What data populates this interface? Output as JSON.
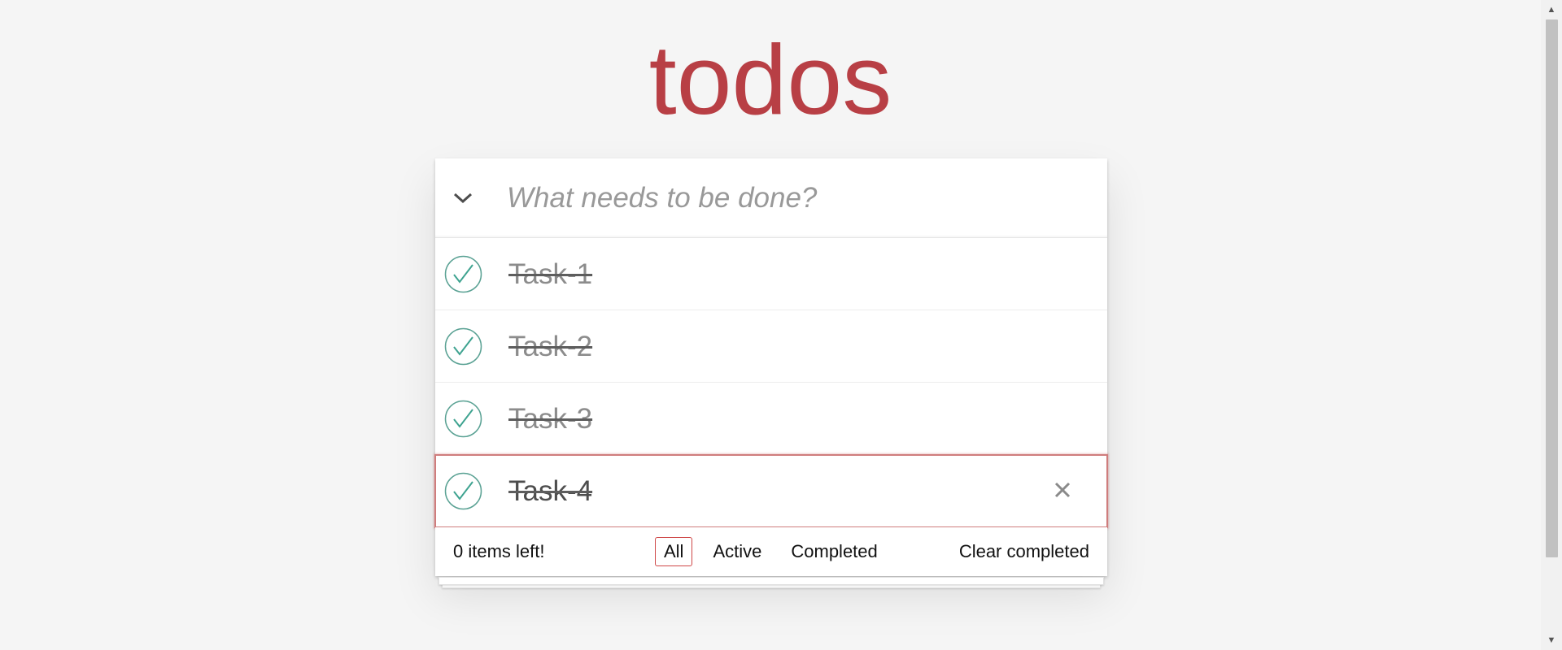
{
  "app": {
    "title": "todos"
  },
  "new_todo": {
    "placeholder": "What needs to be done?",
    "value": ""
  },
  "todos": [
    {
      "label": "Task-1",
      "completed": true
    },
    {
      "label": "Task-2",
      "completed": true
    },
    {
      "label": "Task-3",
      "completed": true
    },
    {
      "label": "Task-4",
      "completed": true
    }
  ],
  "footer": {
    "count_label": "0 items left!",
    "filters": [
      {
        "label": "All",
        "selected": true
      },
      {
        "label": "Active",
        "selected": false
      },
      {
        "label": "Completed",
        "selected": false
      }
    ],
    "clear_label": "Clear completed"
  },
  "colors": {
    "accent": "#b83f45",
    "check": "#3ea390",
    "background": "#f5f5f5"
  }
}
